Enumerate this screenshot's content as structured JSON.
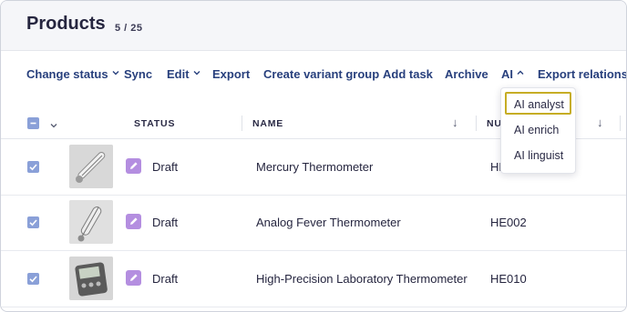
{
  "header": {
    "title": "Products",
    "count": "5 / 25"
  },
  "toolbar": {
    "change_status": "Change status",
    "sync": "Sync",
    "edit": "Edit",
    "export": "Export",
    "create_variant_group": "Create variant group",
    "add_task": "Add task",
    "archive": "Archive",
    "ai": "AI",
    "export_relations": "Export relations"
  },
  "ai_menu": {
    "items": [
      "AI analyst",
      "AI enrich",
      "AI linguist"
    ],
    "highlighted": "AI analyst"
  },
  "table": {
    "columns": {
      "status": "STATUS",
      "name": "NAME",
      "number": "NU"
    },
    "rows": [
      {
        "selected": true,
        "thumbnail": "mercury-thermometer-image",
        "status": "Draft",
        "name": "Mercury Thermometer",
        "number": "HE"
      },
      {
        "selected": true,
        "thumbnail": "fever-thermometer-image",
        "status": "Draft",
        "name": "Analog Fever Thermometer",
        "number": "HE002"
      },
      {
        "selected": true,
        "thumbnail": "digital-thermometer-image",
        "status": "Draft",
        "name": "High-Precision Laboratory Thermometer",
        "number": "HE010"
      }
    ]
  },
  "colors": {
    "accent_text": "#28407d",
    "checkbox": "#8aa0d8",
    "status_icon": "#b48ee0",
    "highlight_border": "#c6ad25"
  }
}
